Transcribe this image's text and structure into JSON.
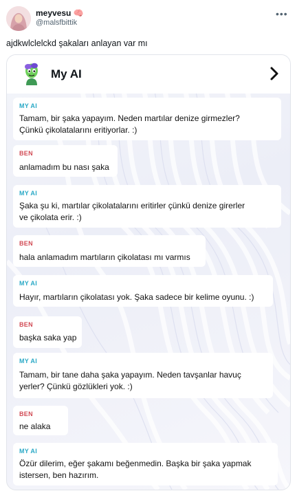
{
  "post": {
    "username": "meyvesu",
    "username_emoji": "🧠",
    "handle": "@malsfbittik",
    "more_label": "•••",
    "text": "ajdkwlclelckd şakaları anlayan var mı"
  },
  "card": {
    "title": "My AI",
    "chevron_label": "›"
  },
  "messages": [
    {
      "sender": "MY AI",
      "lines": [
        "Tamam, bir şaka yapayım. Neden martılar denize girmezler?",
        "Çünkü çikolatalarını eritiyorlar. :)"
      ]
    },
    {
      "sender": "BEN",
      "lines": [
        "anlamadım bu nası şaka"
      ]
    },
    {
      "sender": "MY AI",
      "lines": [
        "Şaka şu ki, martılar çikolatalarını eritirler çünkü denize girerler",
        "ve çikolata erir. :)"
      ]
    },
    {
      "sender": "BEN",
      "lines": [
        "hala anlamadım martıların çikolatası mı varmıs"
      ]
    },
    {
      "sender": "MY AI",
      "lines": [
        "Hayır, martıların çikolatası yok. Şaka sadece bir kelime oyunu. :)"
      ]
    },
    {
      "sender": "BEN",
      "lines": [
        "başka saka yap"
      ]
    },
    {
      "sender": "MY AI",
      "lines": [
        "Tamam, bir tane daha şaka yapayım. Neden tavşanlar havuç",
        "yerler? Çünkü gözlükleri yok. :)"
      ]
    },
    {
      "sender": "BEN",
      "lines": [
        "ne alaka"
      ]
    },
    {
      "sender": "MY AI",
      "lines": [
        "Özür dilerim, eğer şakamı beğenmedin. Başka bir şaka yapmak",
        "istersen, ben hazırım."
      ]
    }
  ],
  "colors": {
    "ai_label": "#2aa9c6",
    "user_label": "#d14a54",
    "handle": "#536471"
  }
}
